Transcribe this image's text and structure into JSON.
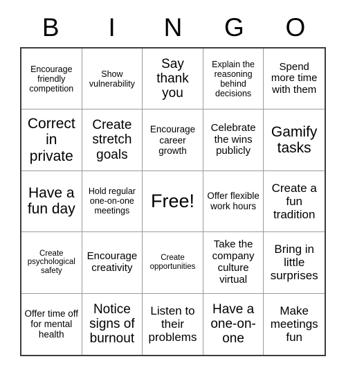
{
  "card": {
    "header_letters": [
      "B",
      "I",
      "N",
      "G",
      "O"
    ],
    "columns": 5,
    "rows": 5,
    "free_space_index": 12,
    "colors": {
      "background": "#ffffff",
      "text": "#000000",
      "outer_border": "#3c3c3c",
      "inner_border": "#9a9a9a"
    },
    "cells": [
      {
        "text": "Encourage friendly competition",
        "size": "fs-12"
      },
      {
        "text": "Show vulnerability",
        "size": "fs-12"
      },
      {
        "text": "Say thank you",
        "size": "fs-19"
      },
      {
        "text": "Explain the reasoning behind decisions",
        "size": "fs-12"
      },
      {
        "text": "Spend more time with them",
        "size": "fs-15"
      },
      {
        "text": "Correct in private",
        "size": "fs-21"
      },
      {
        "text": "Create stretch goals",
        "size": "fs-19"
      },
      {
        "text": "Encourage career growth",
        "size": "fs-13"
      },
      {
        "text": "Celebrate the wins publicly",
        "size": "fs-15"
      },
      {
        "text": "Gamify tasks",
        "size": "fs-21"
      },
      {
        "text": "Have a fun day",
        "size": "fs-21"
      },
      {
        "text": "Hold regular one-on-one meetings",
        "size": "fs-12"
      },
      {
        "text": "Free!",
        "size": "fs-free"
      },
      {
        "text": "Offer flexible work hours",
        "size": "fs-13"
      },
      {
        "text": "Create a fun tradition",
        "size": "fs-17"
      },
      {
        "text": "Create psychological safety",
        "size": "fs-11"
      },
      {
        "text": "Encourage creativity",
        "size": "fs-15"
      },
      {
        "text": "Create opportunities",
        "size": "fs-11"
      },
      {
        "text": "Take the company culture virtual",
        "size": "fs-15"
      },
      {
        "text": "Bring in little surprises",
        "size": "fs-17"
      },
      {
        "text": "Offer time off for mental health",
        "size": "fs-13"
      },
      {
        "text": "Notice signs of burnout",
        "size": "fs-19"
      },
      {
        "text": "Listen to their problems",
        "size": "fs-17"
      },
      {
        "text": "Have a one-on-one",
        "size": "fs-19"
      },
      {
        "text": "Make meetings fun",
        "size": "fs-17"
      }
    ]
  }
}
